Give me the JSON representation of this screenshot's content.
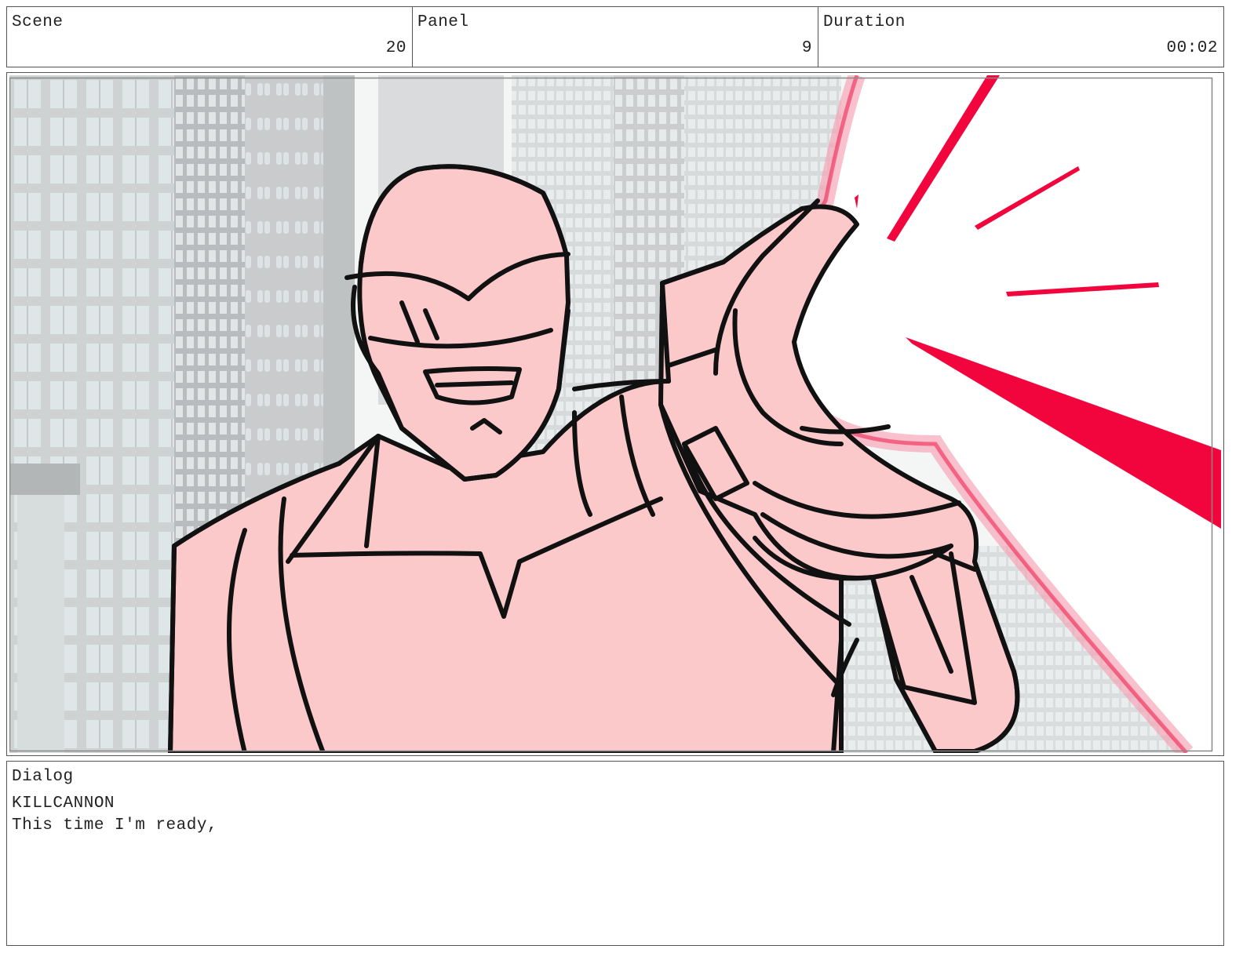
{
  "header": {
    "scene": {
      "label": "Scene",
      "value": "20"
    },
    "panel": {
      "label": "Panel",
      "value": "9"
    },
    "duration": {
      "label": "Duration",
      "value": "00:02"
    }
  },
  "illustration": {
    "subject": "storyboard-sketch",
    "colors": {
      "figure_fill": "#fcc9cb",
      "ink": "#111111",
      "blast": "#f2053c",
      "building": "#cccccc",
      "window": "#dfe6e8"
    }
  },
  "dialog": {
    "label": "Dialog",
    "character": "KILLCANNON",
    "line": "This time I'm ready,"
  }
}
